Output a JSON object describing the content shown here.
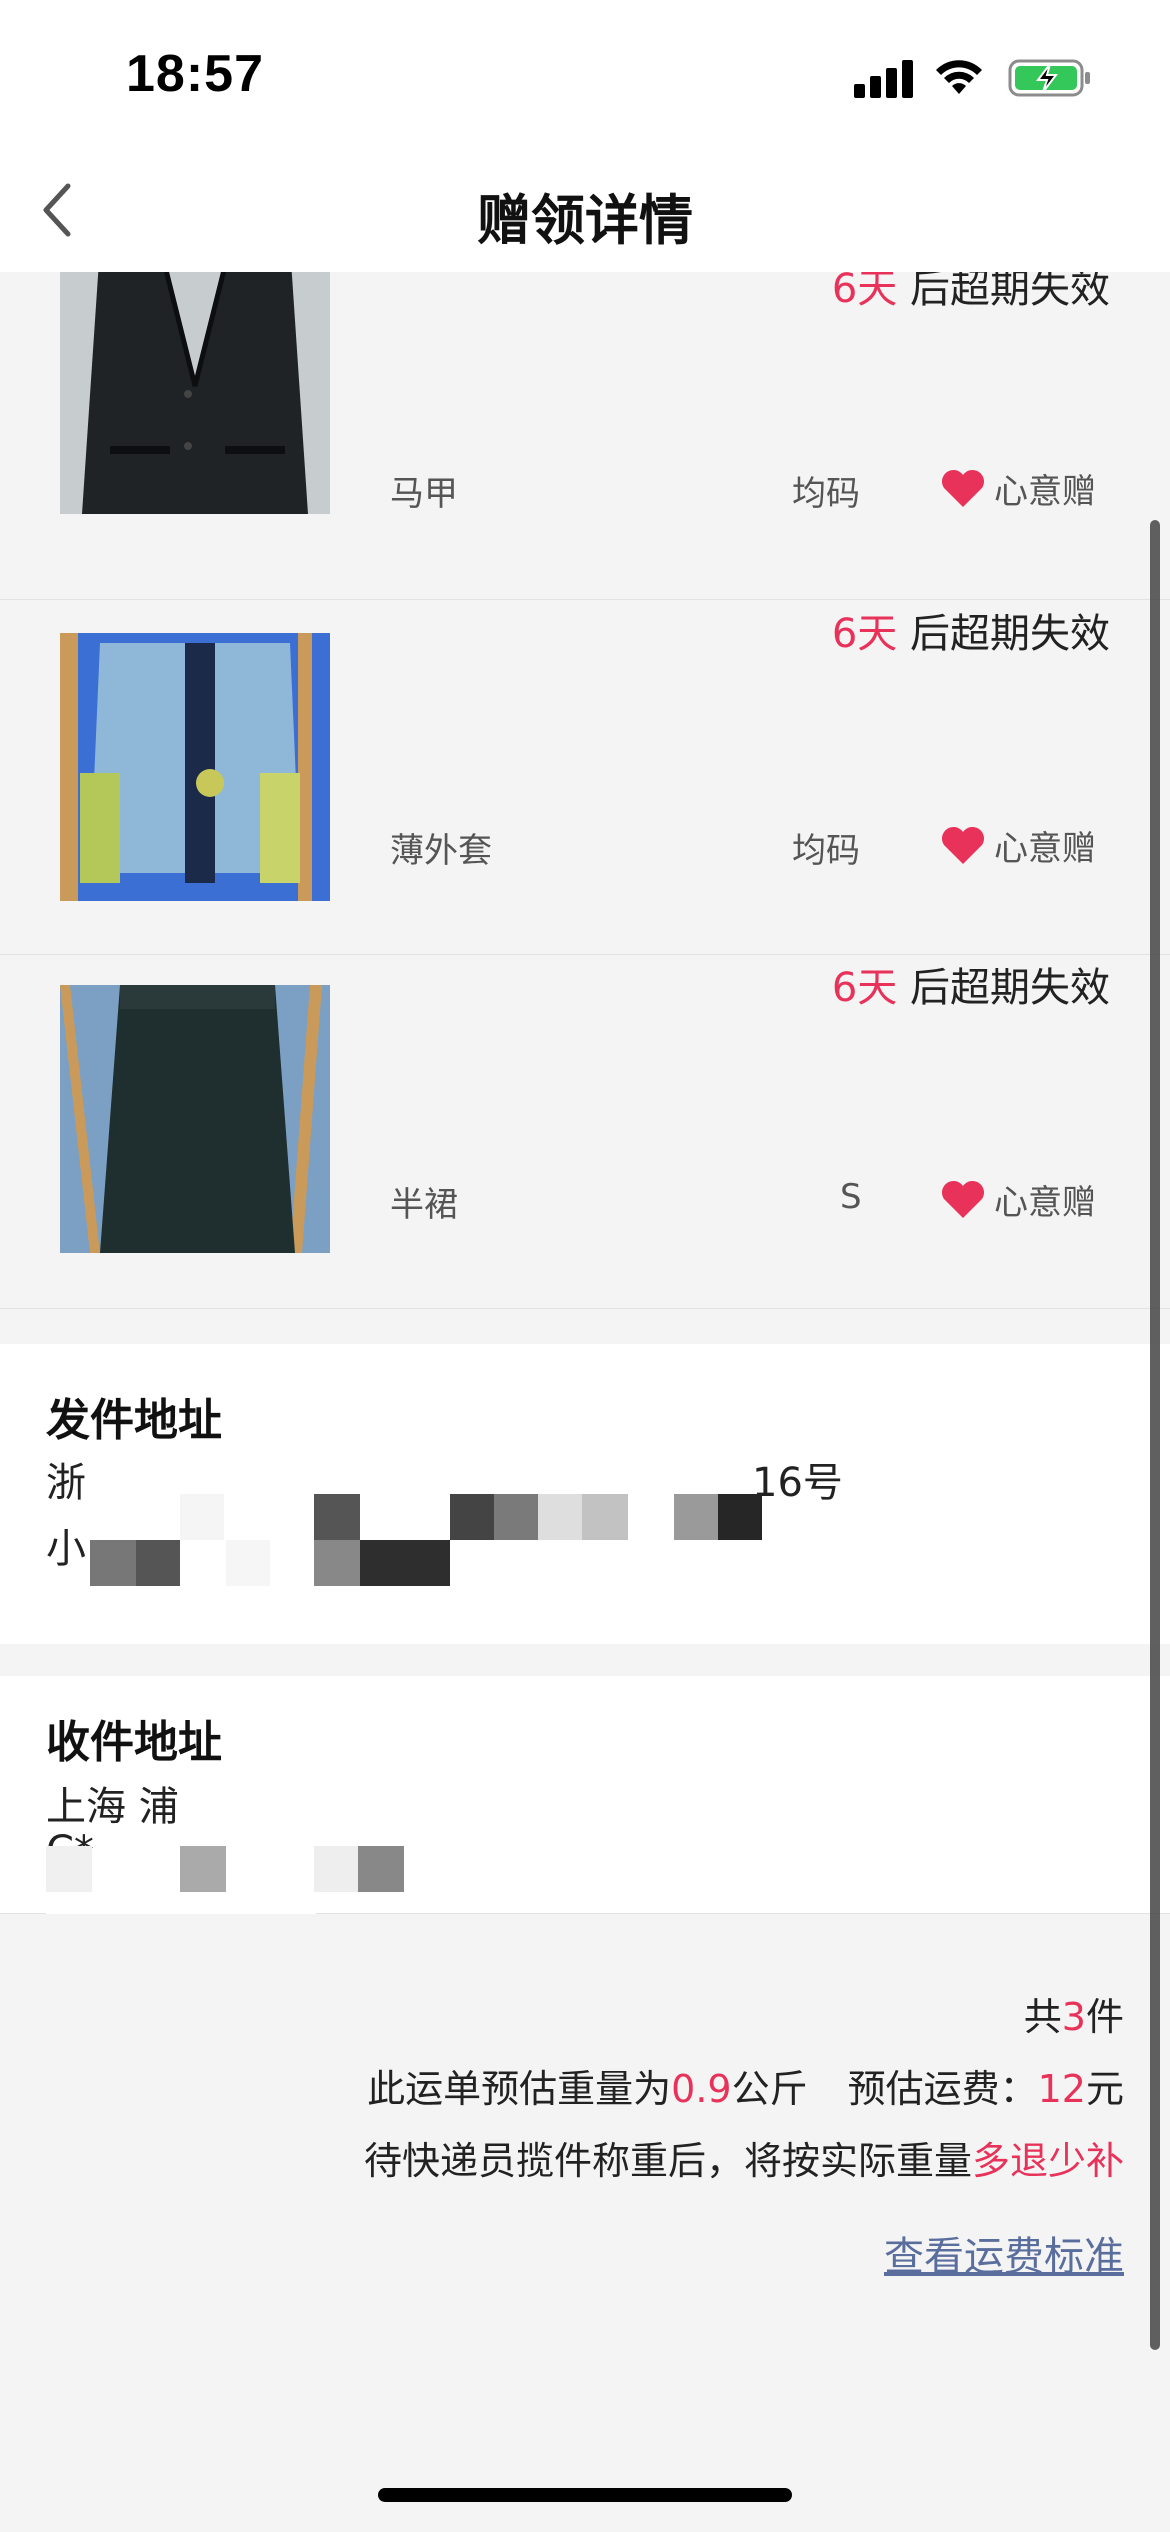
{
  "status": {
    "time": "18:57"
  },
  "nav": {
    "title": "赠领详情"
  },
  "items": [
    {
      "expire_days": "6天",
      "expire_suffix": " 后超期失效",
      "name": "马甲",
      "size": "均码",
      "gift_label": "心意赠",
      "thumb_icon": "vest-photo"
    },
    {
      "expire_days": "6天",
      "expire_suffix": " 后超期失效",
      "name": "薄外套",
      "size": "均码",
      "gift_label": "心意赠",
      "thumb_icon": "jacket-photo"
    },
    {
      "expire_days": "6天",
      "expire_suffix": " 后超期失效",
      "name": "半裙",
      "size": "S",
      "gift_label": "心意赠",
      "thumb_icon": "skirt-photo"
    }
  ],
  "sender": {
    "title": "发件地址",
    "line1": "浙",
    "line1_tail": "16号",
    "line2": "小"
  },
  "receiver": {
    "title": "收件地址",
    "line1": "上海 浦",
    "line2": "C*"
  },
  "summary": {
    "count_prefix": "共",
    "count": "3",
    "count_suffix": "件",
    "weight_prefix": "此运单预估重量为",
    "weight": "0.9",
    "weight_unit": "公斤",
    "fee_label": "预估运费：",
    "fee": "12",
    "fee_unit": "元",
    "note_prefix": "待快递员揽件称重后，将按实际重量",
    "note_highlight": "多退少补",
    "link": "查看运费标准"
  },
  "colors": {
    "accent": "#e8325a",
    "link": "#5a6e9e"
  }
}
